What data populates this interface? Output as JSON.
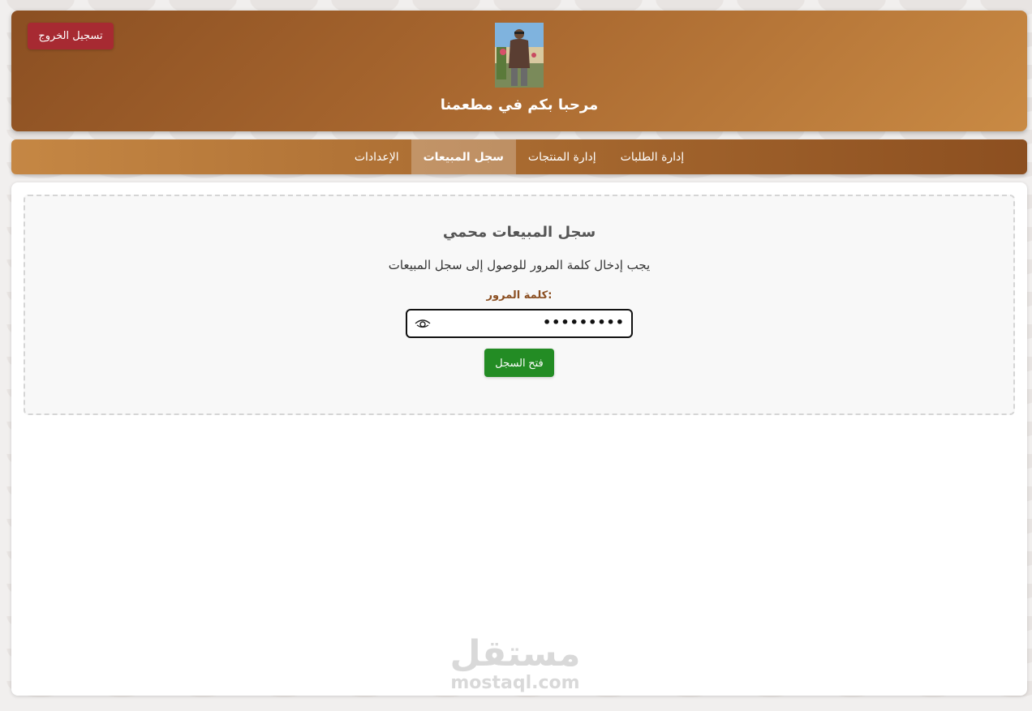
{
  "header": {
    "logout_label": "تسجيل الخروج",
    "welcome_text": "مرحبا بكم في مطعمنا",
    "background_start": "#8b4f22",
    "background_end": "#c98a44"
  },
  "nav": {
    "items": [
      {
        "label": "إدارة الطلبات",
        "active": false
      },
      {
        "label": "إدارة المنتجات",
        "active": false
      },
      {
        "label": "سجل المبيعات",
        "active": true
      },
      {
        "label": "الإعدادات",
        "active": false
      }
    ]
  },
  "locked": {
    "title": "سجل المبيعات محمي",
    "message": "يجب إدخال كلمة المرور للوصول إلى سجل المبيعات",
    "password_label": "كلمة المرور:",
    "password_value": "•••••••••",
    "open_button_label": "فتح السجل"
  },
  "watermark": {
    "arabic": "مستقل",
    "latin": "mostaql.com"
  },
  "colors": {
    "logout": "#a72a32",
    "open_button": "#238c24",
    "label_brown": "#8b4f22"
  },
  "icons": {
    "avatar": "user-photo",
    "password_toggle": "eye-icon"
  }
}
